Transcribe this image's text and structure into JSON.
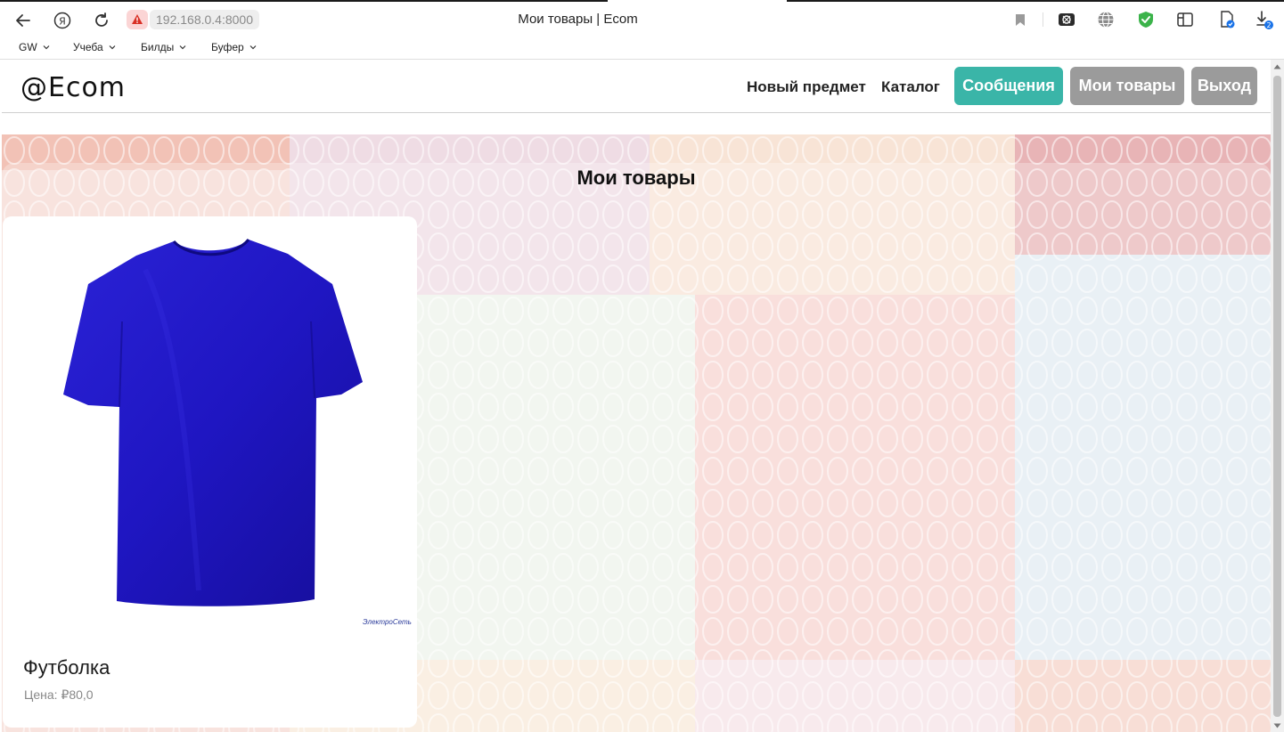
{
  "browser": {
    "url": "192.168.0.4:8000",
    "tab_title": "Мои товары | Ecom",
    "download_badge": "2"
  },
  "bookmarks": [
    {
      "label": "GW"
    },
    {
      "label": "Учеба"
    },
    {
      "label": "Билды"
    },
    {
      "label": "Буфер"
    }
  ],
  "site": {
    "logo": "@Ecom",
    "nav": {
      "new_item": "Новый предмет",
      "catalog": "Каталог",
      "messages": "Сообщения",
      "my_items": "Мои товары",
      "logout": "Выход"
    },
    "colors": {
      "messages_bg": "#3ab5a8",
      "my_items_bg": "#9b9b9b",
      "logout_bg": "#9b9b9b"
    }
  },
  "main": {
    "title": "Мои товары",
    "products": [
      {
        "name": "Футболка",
        "price_label": "Цена: ₽80,0",
        "image": "blue-tshirt",
        "watermark": "ЭлектроСеть"
      }
    ]
  }
}
